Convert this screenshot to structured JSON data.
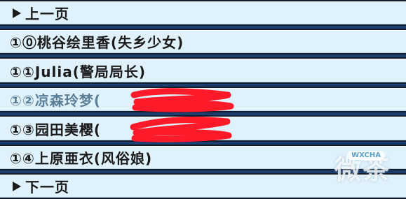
{
  "menu": {
    "prev_label": "上一页",
    "items": [
      {
        "label": "①⓪桃谷绘里香(失乡少女)"
      },
      {
        "label": "①①Julia(警局局长)"
      },
      {
        "label": "①②凉森玲梦(",
        "redacted": true
      },
      {
        "label": "①③园田美樱(",
        "redacted": true
      },
      {
        "label": "①④上原亜衣(风俗娘)"
      }
    ],
    "next_label": "下一页"
  },
  "watermark": {
    "text": "微茶",
    "badge": "WXCHA"
  },
  "colors": {
    "row_bg": "#dff1fb",
    "border": "#101c2e",
    "text": "#1a1a1a",
    "dim_text": "#5b7f96",
    "redact": "#ff1a2a"
  }
}
